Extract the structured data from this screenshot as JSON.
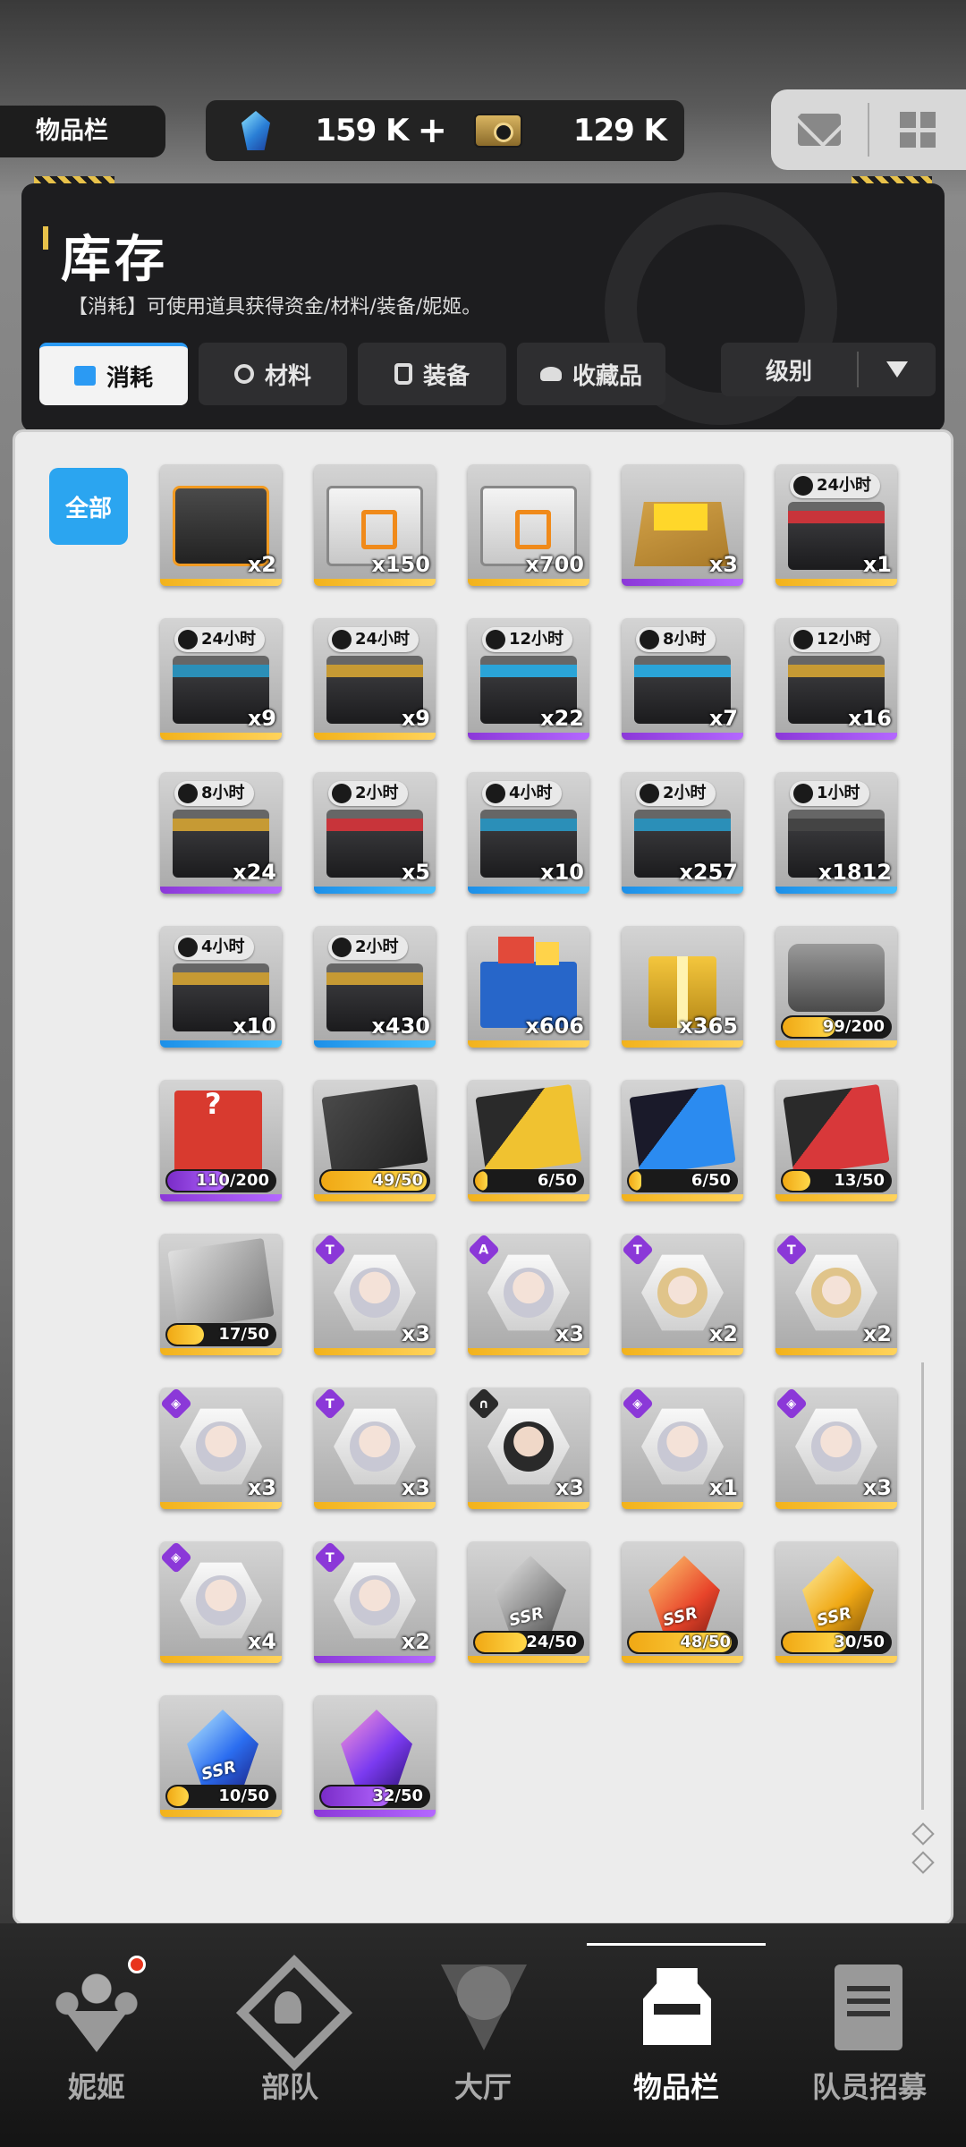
{
  "header": {
    "page_tag": "物品栏",
    "currency": {
      "gem_icon": "gem-icon",
      "gem_amount": "159 K",
      "add_label": "+",
      "ticket_icon": "ticket-icon",
      "ticket_amount": "129 K"
    },
    "buttons": [
      "mail-icon",
      "grid-menu-icon"
    ]
  },
  "inventory": {
    "title": "库存",
    "description": "【消耗】可使用道具获得资金/材料/装备/妮姬。",
    "tabs": [
      {
        "label": "消耗",
        "active": true
      },
      {
        "label": "材料",
        "active": false
      },
      {
        "label": "装备",
        "active": false
      },
      {
        "label": "收藏品",
        "active": false
      }
    ],
    "sort_label": "级别",
    "filter_all": "全部"
  },
  "colors": {
    "accent_blue": "#2ba5f0",
    "rarity_gold": "#f2b21b",
    "rarity_purple": "#8b38d8",
    "rarity_blue": "#1c8fe8",
    "notification_red": "#e8341c"
  },
  "items": [
    {
      "art": "box orange",
      "rarity": "gold",
      "count": "x2"
    },
    {
      "art": "crate",
      "rarity": "gold",
      "count": "x150"
    },
    {
      "art": "crate",
      "rarity": "gold",
      "count": "x700"
    },
    {
      "art": "carton",
      "rarity": "purple",
      "count": "x3"
    },
    {
      "art": "case red",
      "rarity": "gold",
      "count": "x1",
      "timer": "24小时"
    },
    {
      "art": "case teal",
      "rarity": "gold",
      "count": "x9",
      "timer": "24小时"
    },
    {
      "art": "case gold",
      "rarity": "gold",
      "count": "x9",
      "timer": "24小时"
    },
    {
      "art": "case blue",
      "rarity": "purple",
      "count": "x22",
      "timer": "12小时"
    },
    {
      "art": "case blue",
      "rarity": "purple",
      "count": "x7",
      "timer": "8小时"
    },
    {
      "art": "case gold",
      "rarity": "purple",
      "count": "x16",
      "timer": "12小时"
    },
    {
      "art": "case gold",
      "rarity": "purple",
      "count": "x24",
      "timer": "8小时"
    },
    {
      "art": "case red",
      "rarity": "blue",
      "count": "x5",
      "timer": "2小时"
    },
    {
      "art": "case teal",
      "rarity": "blue",
      "count": "x10",
      "timer": "4小时"
    },
    {
      "art": "case teal",
      "rarity": "blue",
      "count": "x257",
      "timer": "2小时"
    },
    {
      "art": "case dark",
      "rarity": "blue",
      "count": "x1812",
      "timer": "1小时"
    },
    {
      "art": "case gold",
      "rarity": "blue",
      "count": "x10",
      "timer": "4小时"
    },
    {
      "art": "case gold",
      "rarity": "blue",
      "count": "x430",
      "timer": "2小时"
    },
    {
      "art": "bluebox",
      "rarity": "gold",
      "count": "x606"
    },
    {
      "art": "gift",
      "rarity": "gold",
      "count": "x365"
    },
    {
      "art": "silver",
      "rarity": "gold",
      "progress": {
        "text": "99/200",
        "value": 99,
        "max": 200,
        "color": "gold"
      }
    },
    {
      "art": "lucky",
      "rarity": "purple",
      "progress": {
        "text": "110/200",
        "value": 110,
        "max": 200,
        "color": "purple"
      }
    },
    {
      "art": "card gray",
      "rarity": "gold",
      "progress": {
        "text": "49/50",
        "value": 49,
        "max": 50,
        "color": "gold"
      }
    },
    {
      "art": "card yellow",
      "rarity": "gold",
      "progress": {
        "text": "6/50",
        "value": 6,
        "max": 50,
        "color": "gold"
      }
    },
    {
      "art": "card blue",
      "rarity": "gold",
      "progress": {
        "text": "6/50",
        "value": 6,
        "max": 50,
        "color": "gold"
      }
    },
    {
      "art": "card red",
      "rarity": "gold",
      "progress": {
        "text": "13/50",
        "value": 13,
        "max": 50,
        "color": "gold"
      }
    },
    {
      "art": "card white",
      "rarity": "gold",
      "progress": {
        "text": "17/50",
        "value": 17,
        "max": 50,
        "color": "gold"
      }
    },
    {
      "art": "hex",
      "rarity": "gold",
      "count": "x3",
      "badge": "T",
      "badge_color": "purple"
    },
    {
      "art": "hex",
      "rarity": "gold",
      "count": "x3",
      "badge": "A",
      "badge_color": "purple"
    },
    {
      "art": "hex blonde",
      "rarity": "gold",
      "count": "x2",
      "badge": "T",
      "badge_color": "purple"
    },
    {
      "art": "hex blonde",
      "rarity": "gold",
      "count": "x2",
      "badge": "T",
      "badge_color": "purple"
    },
    {
      "art": "hex",
      "rarity": "gold",
      "count": "x3",
      "badge": "◈",
      "badge_color": "purple"
    },
    {
      "art": "hex",
      "rarity": "gold",
      "count": "x3",
      "badge": "T",
      "badge_color": "purple"
    },
    {
      "art": "hex dark",
      "rarity": "gold",
      "count": "x3",
      "badge": "∩",
      "badge_color": "dark"
    },
    {
      "art": "hex",
      "rarity": "gold",
      "count": "x1",
      "badge": "◈",
      "badge_color": "purple"
    },
    {
      "art": "hex",
      "rarity": "gold",
      "count": "x3",
      "badge": "◈",
      "badge_color": "purple"
    },
    {
      "art": "hex",
      "rarity": "gold",
      "count": "x4",
      "badge": "◈",
      "badge_color": "purple"
    },
    {
      "art": "hex",
      "rarity": "purple",
      "count": "x2",
      "badge": "T",
      "badge_color": "purple"
    },
    {
      "art": "gem white",
      "rarity": "gold",
      "ssr": "SSR",
      "progress": {
        "text": "24/50",
        "value": 24,
        "max": 50,
        "color": "gold"
      }
    },
    {
      "art": "gem red",
      "rarity": "gold",
      "ssr": "SSR",
      "progress": {
        "text": "48/50",
        "value": 48,
        "max": 50,
        "color": "gold"
      }
    },
    {
      "art": "gem gold",
      "rarity": "gold",
      "ssr": "SSR",
      "progress": {
        "text": "30/50",
        "value": 30,
        "max": 50,
        "color": "gold"
      }
    },
    {
      "art": "gem blue",
      "rarity": "gold",
      "ssr": "SSR",
      "progress": {
        "text": "10/50",
        "value": 10,
        "max": 50,
        "color": "gold"
      }
    },
    {
      "art": "gem purple",
      "rarity": "purple",
      "progress": {
        "text": "32/50",
        "value": 32,
        "max": 50,
        "color": "purple"
      }
    }
  ],
  "bottom_nav": [
    {
      "label": "妮姬",
      "icon": "nikke-icon",
      "active": false,
      "notification": true
    },
    {
      "label": "部队",
      "icon": "squad-icon",
      "active": false
    },
    {
      "label": "大厅",
      "icon": "lobby-icon",
      "active": false
    },
    {
      "label": "物品栏",
      "icon": "inventory-icon",
      "active": true
    },
    {
      "label": "队员招募",
      "icon": "recruit-icon",
      "active": false
    }
  ]
}
